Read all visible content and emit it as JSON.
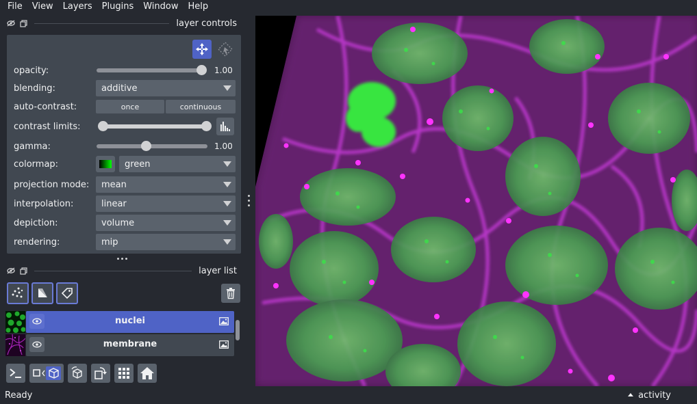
{
  "menu": [
    "File",
    "View",
    "Layers",
    "Plugins",
    "Window",
    "Help"
  ],
  "layer_controls": {
    "title": "layer controls",
    "opacity": {
      "label": "opacity:",
      "value": "1.00",
      "fraction": 1.0
    },
    "blending": {
      "label": "blending:",
      "value": "additive"
    },
    "auto_contrast": {
      "label": "auto-contrast:",
      "once": "once",
      "continuous": "continuous"
    },
    "contrast_limits": {
      "label": "contrast limits:"
    },
    "gamma": {
      "label": "gamma:",
      "value": "1.00",
      "fraction": 0.45
    },
    "colormap": {
      "label": "colormap:",
      "value": "green"
    },
    "projection_mode": {
      "label": "projection mode:",
      "value": "mean"
    },
    "interpolation": {
      "label": "interpolation:",
      "value": "linear"
    },
    "depiction": {
      "label": "depiction:",
      "value": "volume"
    },
    "rendering": {
      "label": "rendering:",
      "value": "mip"
    }
  },
  "layer_list": {
    "title": "layer list",
    "layers": [
      {
        "name": "nuclei",
        "selected": true
      },
      {
        "name": "membrane",
        "selected": false
      }
    ]
  },
  "status": {
    "text": "Ready",
    "activity": "activity"
  },
  "colors": {
    "accent": "#4f63c6",
    "panel": "#414851",
    "background": "#262930",
    "magenta": "#c43bd6",
    "green": "#3be049"
  }
}
